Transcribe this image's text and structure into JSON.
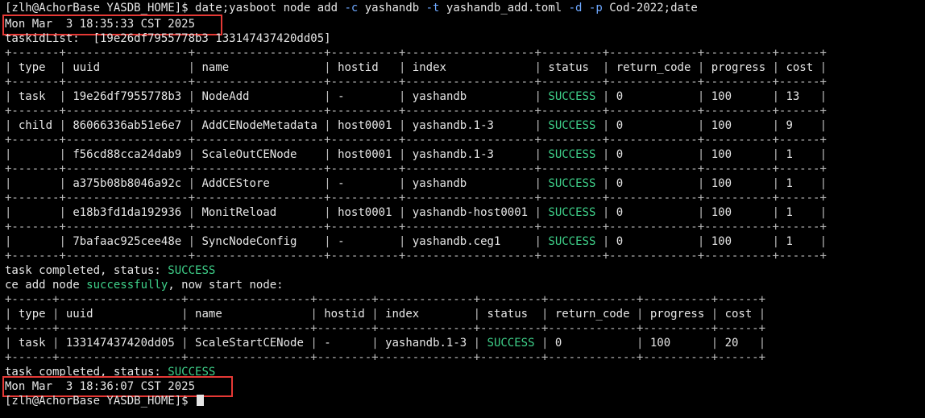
{
  "terminal": {
    "prompt": "[zlh@AchorBase YASDB_HOME]$ ",
    "command": {
      "p1": "date;yasboot node add ",
      "f1": "-c",
      "p2": " yashandb ",
      "f2": "-t",
      "p3": " yashandb_add.toml ",
      "f3": "-d",
      "p4": " ",
      "f4": "-p",
      "p5": " Cod-2022;date"
    },
    "start_date": "Mon Mar  3 18:35:33 CST 2025",
    "tasklist_line": "taskidList:  [19e26df7955778b3 133147437420dd05]",
    "table1": {
      "headers": [
        "type",
        "uuid",
        "name",
        "hostid",
        "index",
        "status",
        "return_code",
        "progress",
        "cost"
      ],
      "rows": [
        [
          "task",
          "19e26df7955778b3",
          "NodeAdd",
          "-",
          "yashandb",
          "SUCCESS",
          "0",
          "100",
          "13"
        ],
        [
          "child",
          "86066336ab51e6e7",
          "AddCENodeMetadata",
          "host0001",
          "yashandb.1-3",
          "SUCCESS",
          "0",
          "100",
          "9"
        ],
        [
          "",
          "f56cd88cca24dab9",
          "ScaleOutCENode",
          "host0001",
          "yashandb.1-3",
          "SUCCESS",
          "0",
          "100",
          "1"
        ],
        [
          "",
          "a375b08b8046a92c",
          "AddCEStore",
          "-",
          "yashandb",
          "SUCCESS",
          "0",
          "100",
          "1"
        ],
        [
          "",
          "e18b3fd1da192936",
          "MonitReload",
          "host0001",
          "yashandb-host0001",
          "SUCCESS",
          "0",
          "100",
          "1"
        ],
        [
          "",
          "7bafaac925cee48e",
          "SyncNodeConfig",
          "-",
          "yashandb.ceg1",
          "SUCCESS",
          "0",
          "100",
          "1"
        ]
      ]
    },
    "completed_1": {
      "prefix": "task completed, status: ",
      "status": "SUCCESS"
    },
    "ce_add": {
      "p1": "ce add node ",
      "word": "successfully",
      "p2": ", now start node:"
    },
    "table2": {
      "headers": [
        "type",
        "uuid",
        "name",
        "hostid",
        "index",
        "status",
        "return_code",
        "progress",
        "cost"
      ],
      "rows": [
        [
          "task",
          "133147437420dd05",
          "ScaleStartCENode",
          "-",
          "yashandb.1-3",
          "SUCCESS",
          "0",
          "100",
          "20"
        ]
      ]
    },
    "completed_2": {
      "prefix": "task completed, status: ",
      "status": "SUCCESS"
    },
    "end_date": "Mon Mar  3 18:36:07 CST 2025",
    "final_prompt": "[zlh@AchorBase YASDB_HOME]$ "
  },
  "colors": {
    "background": "#000000",
    "text": "#e6e6e6",
    "success": "#3fd18a",
    "flag": "#6ea8ff",
    "highlight_box": "#e53935"
  }
}
